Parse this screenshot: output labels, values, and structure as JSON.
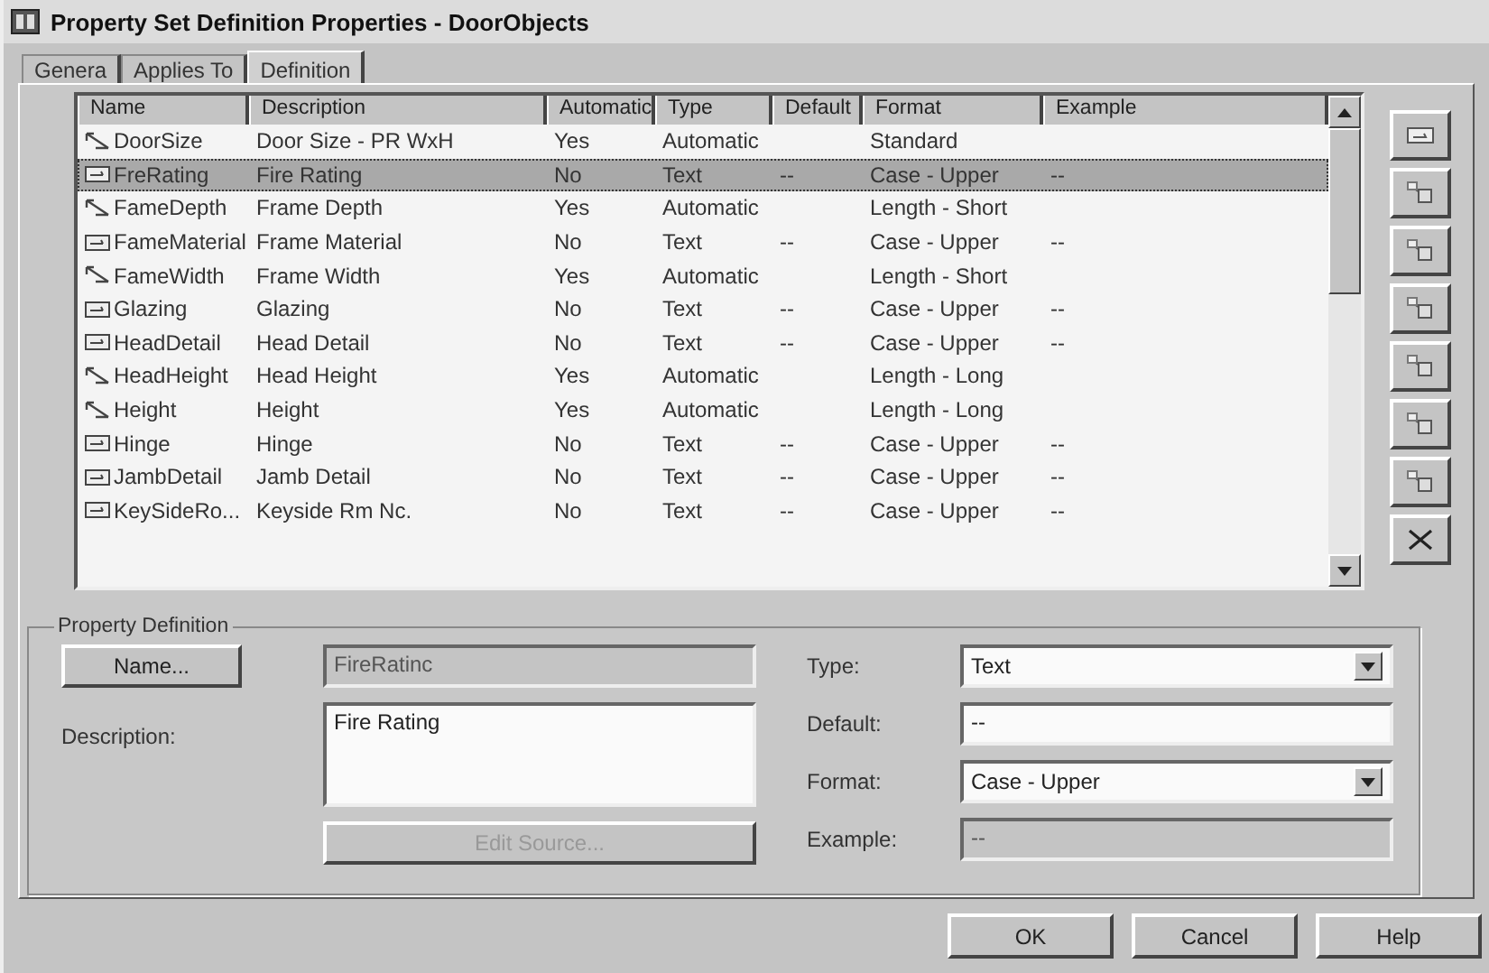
{
  "window": {
    "title": "Property Set Definition Properties - DoorObjects"
  },
  "tabs": [
    {
      "label": "Genera",
      "selected": false
    },
    {
      "label": "Applies To",
      "selected": false
    },
    {
      "label": "Definition",
      "selected": true
    }
  ],
  "table": {
    "columns": [
      "Name",
      "Description",
      "Automatic",
      "Type",
      "Default",
      "Format",
      "Example"
    ],
    "rows": [
      {
        "kind": "automatic",
        "selected": false,
        "cells": [
          "DoorSize",
          "Door Size - PR WxH",
          "Yes",
          "Automatic",
          "",
          "Standard",
          ""
        ]
      },
      {
        "kind": "text",
        "selected": true,
        "cells": [
          "FreRating",
          "Fire Rating",
          "No",
          "Text",
          "--",
          "Case - Upper",
          "--"
        ]
      },
      {
        "kind": "automatic",
        "selected": false,
        "cells": [
          "FameDepth",
          "Frame Depth",
          "Yes",
          "Automatic",
          "",
          "Length - Short",
          ""
        ]
      },
      {
        "kind": "text",
        "selected": false,
        "cells": [
          "FameMaterial",
          "Frame Material",
          "No",
          "Text",
          "--",
          "Case - Upper",
          "--"
        ]
      },
      {
        "kind": "automatic",
        "selected": false,
        "cells": [
          "FameWidth",
          "Frame Width",
          "Yes",
          "Automatic",
          "",
          "Length - Short",
          ""
        ]
      },
      {
        "kind": "text",
        "selected": false,
        "cells": [
          "Glazing",
          "Glazing",
          "No",
          "Text",
          "--",
          "Case - Upper",
          "--"
        ]
      },
      {
        "kind": "text",
        "selected": false,
        "cells": [
          "HeadDetail",
          "Head Detail",
          "No",
          "Text",
          "--",
          "Case - Upper",
          "--"
        ]
      },
      {
        "kind": "automatic",
        "selected": false,
        "cells": [
          "HeadHeight",
          "Head Height",
          "Yes",
          "Automatic",
          "",
          "Length - Long",
          ""
        ]
      },
      {
        "kind": "automatic",
        "selected": false,
        "cells": [
          "Height",
          "Height",
          "Yes",
          "Automatic",
          "",
          "Length - Long",
          ""
        ]
      },
      {
        "kind": "text",
        "selected": false,
        "cells": [
          "Hinge",
          "Hinge",
          "No",
          "Text",
          "--",
          "Case - Upper",
          "--"
        ]
      },
      {
        "kind": "text",
        "selected": false,
        "cells": [
          "JambDetail",
          "Jamb Detail",
          "No",
          "Text",
          "--",
          "Case - Upper",
          "--"
        ]
      },
      {
        "kind": "text",
        "selected": false,
        "cells": [
          "KeySideRo...",
          "Keyside Rm Nc.",
          "No",
          "Text",
          "--",
          "Case - Upper",
          "--"
        ]
      }
    ]
  },
  "property_definition": {
    "title": "Property Definition",
    "name_button": "Name...",
    "name_value": "FireRatinc",
    "description_label": "Description:",
    "description_value": "Fire Rating",
    "edit_source_button": "Edit Source...",
    "edit_source_disabled": true,
    "type_label": "Type:",
    "type_value": "Text",
    "default_label": "Default:",
    "default_value": "--",
    "format_label": "Format:",
    "format_value": "Case - Upper",
    "example_label": "Example:",
    "example_value": "--"
  },
  "buttons": [
    "OK",
    "Cancel",
    "Help"
  ]
}
